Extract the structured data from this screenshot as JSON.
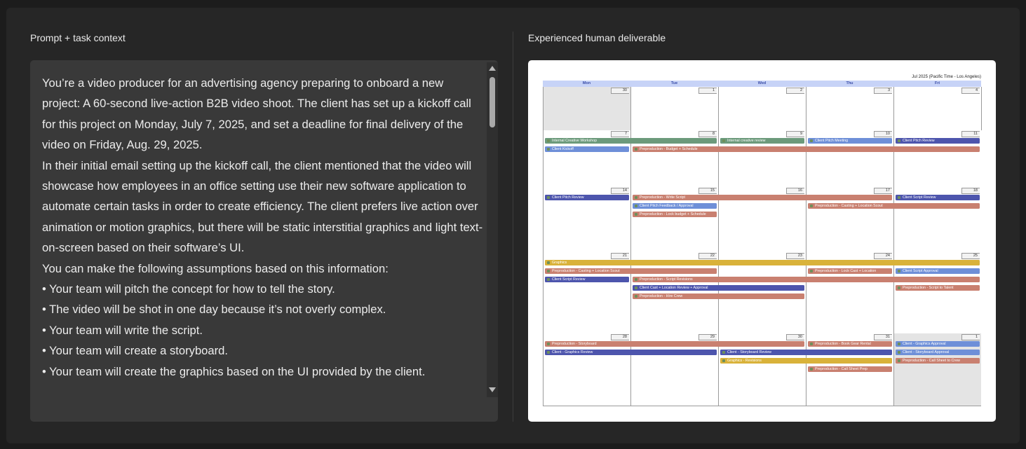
{
  "left_panel": {
    "title": "Prompt + task context",
    "paragraphs": [
      "You’re a video producer for an advertising agency preparing to onboard a new project: A 60-second live-action B2B video shoot. The client has set up a kickoff call for this project on Monday, July 7, 2025, and set a deadline for final delivery of the video on Friday, Aug. 29, 2025.",
      "In their initial email setting up the kickoff call, the client mentioned that the video will showcase how employees in an office setting use their new software application to automate certain tasks in order to create efficiency. The client prefers live action over animation or motion graphics, but there will be static interstitial graphics and light text-on-screen based on their software’s UI.",
      "You can make the following assumptions based on this information:",
      "• Your team will pitch the concept for how to tell the story.",
      "• The video will be shot in one day because it’s not overly complex.",
      "• Your team will write the script.",
      "• Your team will create a storyboard.",
      "• Your team will create the graphics based on the UI provided by the client."
    ]
  },
  "right_panel": {
    "title": "Experienced human deliverable",
    "calendar": {
      "caption": "Jul 2025 (Pacific Time - Los Angeles)",
      "days_of_week": [
        "Mon",
        "Tue",
        "Wed",
        "Thu",
        "Fri"
      ],
      "colors": {
        "green": "#6c9a7b",
        "blue": "#6e8fd8",
        "salmon": "#c98070",
        "indigo": "#4d55ad",
        "gold": "#d9b23a"
      },
      "weeks": [
        {
          "days": [
            {
              "num": "30",
              "out": true
            },
            {
              "num": "1"
            },
            {
              "num": "2"
            },
            {
              "num": "3"
            },
            {
              "num": "4"
            }
          ],
          "events": []
        },
        {
          "days": [
            {
              "num": "7"
            },
            {
              "num": "8"
            },
            {
              "num": "9"
            },
            {
              "num": "10"
            },
            {
              "num": "11"
            }
          ],
          "events": [
            {
              "label": "Internal Creative Workshop",
              "start": 0,
              "span": 2,
              "row": 0,
              "color": "#6c9a7b"
            },
            {
              "label": "Internal creative review",
              "start": 2,
              "span": 1,
              "row": 0,
              "color": "#6c9a7b"
            },
            {
              "label": "Client Pitch Meeting",
              "start": 3,
              "span": 1,
              "row": 0,
              "color": "#6e8fd8"
            },
            {
              "label": "Client Pitch Review",
              "start": 4,
              "span": 1,
              "row": 0,
              "color": "#4d55ad"
            },
            {
              "label": "Client Kickoff",
              "start": 0,
              "span": 1,
              "row": 1,
              "color": "#6e8fd8"
            },
            {
              "label": "Preproduction - Budget + Schedule",
              "start": 1,
              "span": 4,
              "row": 1,
              "color": "#c98070"
            }
          ]
        },
        {
          "days": [
            {
              "num": "14"
            },
            {
              "num": "15"
            },
            {
              "num": "16"
            },
            {
              "num": "17"
            },
            {
              "num": "18"
            }
          ],
          "events": [
            {
              "label": "Client Pitch Review",
              "start": 0,
              "span": 1,
              "row": 0,
              "color": "#4d55ad"
            },
            {
              "label": "Preproduction - Write Script",
              "start": 1,
              "span": 3,
              "row": 0,
              "color": "#c98070"
            },
            {
              "label": "Client Script Review",
              "start": 4,
              "span": 1,
              "row": 0,
              "color": "#4d55ad"
            },
            {
              "label": "Client Pitch Feedback / Approval",
              "start": 1,
              "span": 1,
              "row": 1,
              "color": "#6e8fd8"
            },
            {
              "label": "Preproduction - Casting + Location Scout",
              "start": 3,
              "span": 2,
              "row": 1,
              "color": "#c98070"
            },
            {
              "label": "Preproduction - Lock budget + Schedule",
              "start": 1,
              "span": 1,
              "row": 2,
              "color": "#c98070"
            }
          ]
        },
        {
          "days": [
            {
              "num": "21"
            },
            {
              "num": "22"
            },
            {
              "num": "23"
            },
            {
              "num": "24"
            },
            {
              "num": "25"
            }
          ],
          "events": [
            {
              "label": "Graphics",
              "start": 0,
              "span": 5,
              "row": 0,
              "color": "#d9b23a"
            },
            {
              "label": "Preproduction - Casting + Location Scout",
              "start": 0,
              "span": 2,
              "row": 1,
              "color": "#c98070"
            },
            {
              "label": "Preproduction - Lock Cast + Location",
              "start": 3,
              "span": 1,
              "row": 1,
              "color": "#c98070"
            },
            {
              "label": "Client Script Approval",
              "start": 4,
              "span": 1,
              "row": 1,
              "color": "#6e8fd8"
            },
            {
              "label": "Client Script Review",
              "start": 0,
              "span": 1,
              "row": 2,
              "color": "#4d55ad"
            },
            {
              "label": "Preproduction - Script Revisions",
              "start": 1,
              "span": 4,
              "row": 2,
              "color": "#c98070"
            },
            {
              "label": "Client Cast + Location Review + Approval",
              "start": 1,
              "span": 2,
              "row": 3,
              "color": "#4d55ad"
            },
            {
              "label": "Preproduction - Script to Talent",
              "start": 4,
              "span": 1,
              "row": 3,
              "color": "#c98070"
            },
            {
              "label": "Preproduction - Hire Crew",
              "start": 1,
              "span": 2,
              "row": 4,
              "color": "#c98070"
            }
          ]
        },
        {
          "days": [
            {
              "num": "28"
            },
            {
              "num": "29"
            },
            {
              "num": "30"
            },
            {
              "num": "31"
            },
            {
              "num": "1",
              "out": true
            }
          ],
          "events": [
            {
              "label": "Preproduction - Storyboard",
              "start": 0,
              "span": 3,
              "row": 0,
              "color": "#c98070"
            },
            {
              "label": "Preproduction - Book Gear Rental",
              "start": 3,
              "span": 1,
              "row": 0,
              "color": "#c98070"
            },
            {
              "label": "Client - Graphics Approval",
              "start": 4,
              "span": 1,
              "row": 0,
              "color": "#6e8fd8"
            },
            {
              "label": "Client - Graphics Review",
              "start": 0,
              "span": 2,
              "row": 1,
              "color": "#4d55ad"
            },
            {
              "label": "Client - Storyboard Review",
              "start": 2,
              "span": 2,
              "row": 1,
              "color": "#4d55ad"
            },
            {
              "label": "Client - Storyboard Approval",
              "start": 4,
              "span": 1,
              "row": 1,
              "color": "#6e8fd8"
            },
            {
              "label": "Graphics - Revisions",
              "start": 2,
              "span": 2,
              "row": 2,
              "color": "#d9b23a"
            },
            {
              "label": "Preproduction - Call Sheet to Crew",
              "start": 4,
              "span": 1,
              "row": 2,
              "color": "#c98070"
            },
            {
              "label": "Preproduction - Call Sheet Prep",
              "start": 3,
              "span": 1,
              "row": 3,
              "color": "#c98070"
            }
          ]
        }
      ]
    }
  }
}
